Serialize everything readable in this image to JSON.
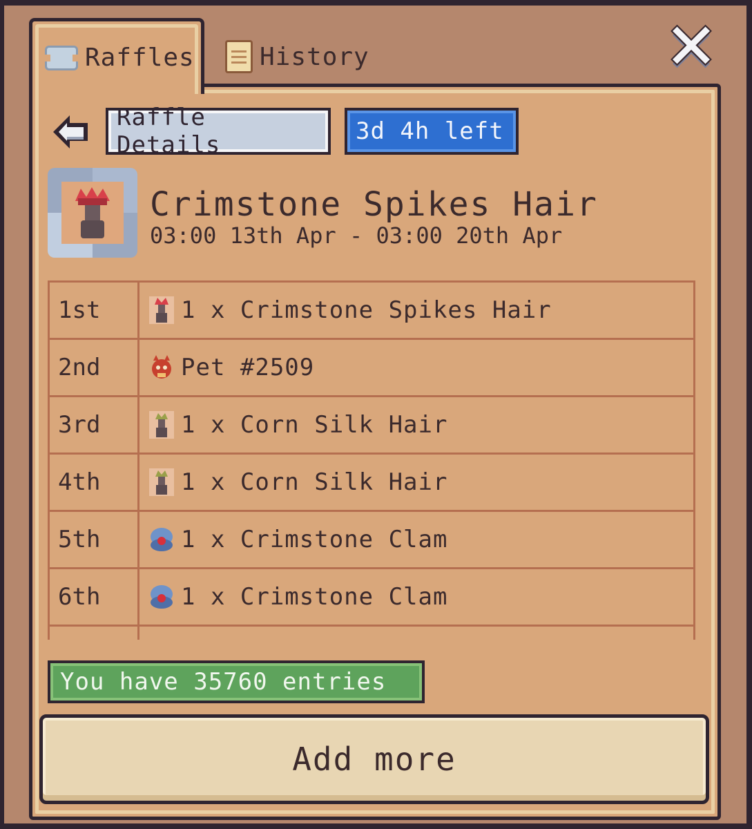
{
  "tabs": {
    "raffles_label": "Raffles",
    "history_label": "History"
  },
  "header": {
    "details_label": "Raffle Details",
    "time_left": "3d 4h left"
  },
  "item": {
    "name": "Crimstone Spikes Hair",
    "dates": "03:00 13th Apr - 03:00 20th Apr"
  },
  "prizes": [
    {
      "rank": "1st",
      "label": "1 x Crimstone Spikes Hair",
      "icon": "hair-icon"
    },
    {
      "rank": "2nd",
      "label": "Pet #2509",
      "icon": "pet-icon"
    },
    {
      "rank": "3rd",
      "label": "1 x Corn Silk Hair",
      "icon": "hair-icon"
    },
    {
      "rank": "4th",
      "label": "1 x Corn Silk Hair",
      "icon": "hair-icon"
    },
    {
      "rank": "5th",
      "label": "1 x Crimstone Clam",
      "icon": "clam-icon"
    },
    {
      "rank": "6th",
      "label": "1 x Crimstone Clam",
      "icon": "clam-icon"
    }
  ],
  "entries": {
    "text": "You have 35760 entries"
  },
  "actions": {
    "add_more_label": "Add more"
  },
  "colors": {
    "panel": "#d9a77b",
    "time_pill": "#2e6fd1",
    "entries_badge": "#5ea35c",
    "button": "#e8d6b3"
  }
}
